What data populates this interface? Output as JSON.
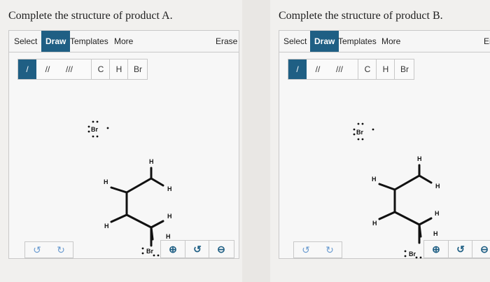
{
  "panel_a": {
    "title": "Complete the structure of product A.",
    "toolbar": {
      "select": "Select",
      "draw": "Draw",
      "templates": "Templates",
      "more": "More",
      "erase": "Erase"
    },
    "bonds": {
      "single": "/",
      "double": "//",
      "triple": "///"
    },
    "atoms": {
      "c": "C",
      "h": "H",
      "br": "Br"
    },
    "molecule": {
      "br_ion": "Br",
      "h1": "H",
      "h2": "H",
      "h3": "H",
      "h4": "H",
      "h5": "H",
      "h6": "H",
      "br_sub": "Br"
    },
    "undo": {
      "undo_icon": "↺",
      "redo_icon": "↻"
    },
    "zoom": {
      "zoom_in_icon": "⊕",
      "reset_icon": "↺",
      "zoom_out_icon": "⊖"
    }
  },
  "panel_b": {
    "title": "Complete the structure of product B.",
    "toolbar": {
      "select": "Select",
      "draw": "Draw",
      "templates": "Templates",
      "more": "More",
      "erase": "Er"
    },
    "bonds": {
      "single": "/",
      "double": "//",
      "triple": "///"
    },
    "atoms": {
      "c": "C",
      "h": "H",
      "br": "Br"
    },
    "molecule": {
      "br_ion": "Br",
      "h1": "H",
      "h2": "H",
      "h3": "H",
      "h4": "H",
      "h5": "H",
      "h6": "H",
      "br_sub": "Br"
    },
    "undo": {
      "undo_icon": "↺",
      "redo_icon": "↻"
    },
    "zoom": {
      "zoom_in_icon": "⊕",
      "reset_icon": "↺",
      "zoom_out_icon": "⊖"
    }
  }
}
